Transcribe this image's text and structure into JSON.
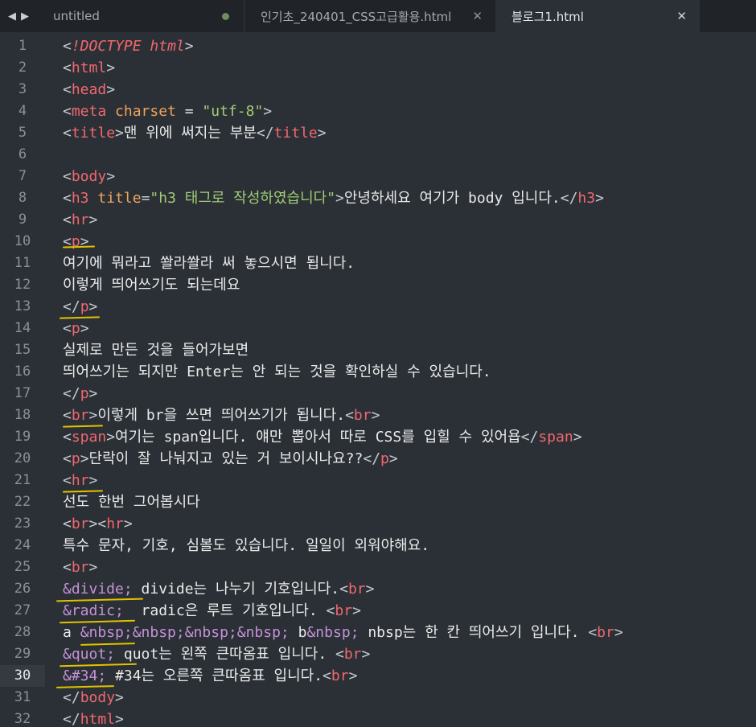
{
  "tabs": [
    {
      "label": "untitled",
      "modified": true
    },
    {
      "label": "인기초_240401_CSS고급활용.html",
      "modified": false
    },
    {
      "label": "블로그1.html",
      "modified": false,
      "active": true
    }
  ],
  "colors": {
    "background": "#2b3036",
    "tab_bar": "#202328",
    "tag": "#f0686e",
    "attribute": "#f0a35e",
    "string": "#a2cc74",
    "entity": "#c592d8",
    "annotation_underline": "#e3c200"
  },
  "icons": {
    "nav_back": "triangle-left-icon",
    "nav_forward": "triangle-right-icon",
    "close": "x-icon",
    "modified": "dot-icon"
  },
  "editor": {
    "current_line": 30,
    "lines": [
      {
        "no": "1",
        "tokens": [
          [
            "p",
            "<"
          ],
          [
            "dt",
            "!DOCTYPE"
          ],
          [
            "txt",
            " "
          ],
          [
            "dt",
            "html"
          ],
          [
            "p",
            ">"
          ]
        ]
      },
      {
        "no": "2",
        "tokens": [
          [
            "p",
            "<"
          ],
          [
            "tag",
            "html"
          ],
          [
            "p",
            ">"
          ]
        ]
      },
      {
        "no": "3",
        "tokens": [
          [
            "p",
            "<"
          ],
          [
            "tag",
            "head"
          ],
          [
            "p",
            ">"
          ]
        ]
      },
      {
        "no": "4",
        "tokens": [
          [
            "p",
            "<"
          ],
          [
            "tag",
            "meta"
          ],
          [
            "txt",
            " "
          ],
          [
            "attr",
            "charset"
          ],
          [
            "txt",
            " = "
          ],
          [
            "str",
            "\"utf-8\""
          ],
          [
            "p",
            ">"
          ]
        ]
      },
      {
        "no": "5",
        "tokens": [
          [
            "p",
            "<"
          ],
          [
            "tag",
            "title"
          ],
          [
            "p",
            ">"
          ],
          [
            "txt",
            "맨 위에 써지는 부분"
          ],
          [
            "p",
            "</"
          ],
          [
            "tag",
            "title"
          ],
          [
            "p",
            ">"
          ]
        ]
      },
      {
        "no": "6",
        "tokens": []
      },
      {
        "no": "7",
        "tokens": [
          [
            "p",
            "<"
          ],
          [
            "tag",
            "body"
          ],
          [
            "p",
            ">"
          ]
        ]
      },
      {
        "no": "8",
        "tokens": [
          [
            "p",
            "<"
          ],
          [
            "tag",
            "h3"
          ],
          [
            "txt",
            " "
          ],
          [
            "attr",
            "title"
          ],
          [
            "p",
            "="
          ],
          [
            "str",
            "\"h3 태그로 작성하였습니다\""
          ],
          [
            "p",
            ">"
          ],
          [
            "txt",
            "안녕하세요 여기가 body 입니다."
          ],
          [
            "p",
            "</"
          ],
          [
            "tag",
            "h3"
          ],
          [
            "p",
            ">"
          ]
        ]
      },
      {
        "no": "9",
        "tokens": [
          [
            "p",
            "<"
          ],
          [
            "tag",
            "hr"
          ],
          [
            "p",
            ">"
          ]
        ]
      },
      {
        "no": "10",
        "tokens": [
          [
            "p",
            "<"
          ],
          [
            "tag",
            "p"
          ],
          [
            "p",
            ">"
          ]
        ]
      },
      {
        "no": "11",
        "tokens": [
          [
            "txt",
            "여기에 뭐라고 쏼라쏼라 써 놓으시면 됩니다."
          ]
        ]
      },
      {
        "no": "12",
        "tokens": [
          [
            "txt",
            "이렇게 띄어쓰기도 되는데요"
          ]
        ]
      },
      {
        "no": "13",
        "tokens": [
          [
            "p",
            "</"
          ],
          [
            "tag",
            "p"
          ],
          [
            "p",
            ">"
          ]
        ]
      },
      {
        "no": "14",
        "tokens": [
          [
            "p",
            "<"
          ],
          [
            "tag",
            "p"
          ],
          [
            "p",
            ">"
          ]
        ]
      },
      {
        "no": "15",
        "tokens": [
          [
            "txt",
            "실제로 만든 것을 들어가보면"
          ]
        ]
      },
      {
        "no": "16",
        "tokens": [
          [
            "txt",
            "띄어쓰기는 되지만 Enter는 안 되는 것을 확인하실 수 있습니다."
          ]
        ]
      },
      {
        "no": "17",
        "tokens": [
          [
            "p",
            "</"
          ],
          [
            "tag",
            "p"
          ],
          [
            "p",
            ">"
          ]
        ]
      },
      {
        "no": "18",
        "tokens": [
          [
            "p",
            "<"
          ],
          [
            "tag",
            "br"
          ],
          [
            "p",
            ">"
          ],
          [
            "txt",
            "이렇게 br을 쓰면 띄어쓰기가 됩니다."
          ],
          [
            "p",
            "<"
          ],
          [
            "tag",
            "br"
          ],
          [
            "p",
            ">"
          ]
        ]
      },
      {
        "no": "19",
        "tokens": [
          [
            "p",
            "<"
          ],
          [
            "tag",
            "span"
          ],
          [
            "p",
            ">"
          ],
          [
            "txt",
            "여기는 span입니다. 얘만 뽑아서 따로 CSS를 입힐 수 있어욥"
          ],
          [
            "p",
            "</"
          ],
          [
            "tag",
            "span"
          ],
          [
            "p",
            ">"
          ]
        ]
      },
      {
        "no": "20",
        "tokens": [
          [
            "p",
            "<"
          ],
          [
            "tag",
            "p"
          ],
          [
            "p",
            ">"
          ],
          [
            "txt",
            "단락이 잘 나눠지고 있는 거 보이시나요??"
          ],
          [
            "p",
            "</"
          ],
          [
            "tag",
            "p"
          ],
          [
            "p",
            ">"
          ]
        ]
      },
      {
        "no": "21",
        "tokens": [
          [
            "p",
            "<"
          ],
          [
            "tag",
            "hr"
          ],
          [
            "p",
            ">"
          ]
        ]
      },
      {
        "no": "22",
        "tokens": [
          [
            "txt",
            "선도 한번 그어봅시다"
          ]
        ]
      },
      {
        "no": "23",
        "tokens": [
          [
            "p",
            "<"
          ],
          [
            "tag",
            "br"
          ],
          [
            "p",
            "><"
          ],
          [
            "tag",
            "hr"
          ],
          [
            "p",
            ">"
          ]
        ]
      },
      {
        "no": "24",
        "tokens": [
          [
            "txt",
            "특수 문자, 기호, 심볼도 있습니다. 일일이 외워야해요."
          ]
        ]
      },
      {
        "no": "25",
        "tokens": [
          [
            "p",
            "<"
          ],
          [
            "tag",
            "br"
          ],
          [
            "p",
            ">"
          ]
        ]
      },
      {
        "no": "26",
        "tokens": [
          [
            "ent",
            "&divide;"
          ],
          [
            "txt",
            " divide는 나누기 기호입니다."
          ],
          [
            "p",
            "<"
          ],
          [
            "tag",
            "br"
          ],
          [
            "p",
            ">"
          ]
        ]
      },
      {
        "no": "27",
        "tokens": [
          [
            "ent",
            "&radic;"
          ],
          [
            "txt",
            "  radic은 루트 기호입니다. "
          ],
          [
            "p",
            "<"
          ],
          [
            "tag",
            "br"
          ],
          [
            "p",
            ">"
          ]
        ]
      },
      {
        "no": "28",
        "tokens": [
          [
            "txt",
            "a "
          ],
          [
            "ent",
            "&nbsp;&nbsp;&nbsp;&nbsp;"
          ],
          [
            "txt",
            " b"
          ],
          [
            "ent",
            "&nbsp;"
          ],
          [
            "txt",
            " nbsp는 한 칸 띄어쓰기 입니다. "
          ],
          [
            "p",
            "<"
          ],
          [
            "tag",
            "br"
          ],
          [
            "p",
            ">"
          ]
        ]
      },
      {
        "no": "29",
        "tokens": [
          [
            "ent",
            "&quot;"
          ],
          [
            "txt",
            " quot는 왼쪽 큰따옴표 입니다. "
          ],
          [
            "p",
            "<"
          ],
          [
            "tag",
            "br"
          ],
          [
            "p",
            ">"
          ]
        ]
      },
      {
        "no": "30",
        "tokens": [
          [
            "ent",
            "&#34;"
          ],
          [
            "txt",
            " #34는 오른쪽 큰따옴표 입니다."
          ],
          [
            "p",
            "<"
          ],
          [
            "tag",
            "br"
          ],
          [
            "p",
            ">"
          ]
        ]
      },
      {
        "no": "31",
        "tokens": [
          [
            "p",
            "</"
          ],
          [
            "tag",
            "body"
          ],
          [
            "p",
            ">"
          ]
        ]
      },
      {
        "no": "32",
        "tokens": [
          [
            "p",
            "</"
          ],
          [
            "tag",
            "html"
          ],
          [
            "p",
            ">"
          ]
        ]
      }
    ]
  }
}
